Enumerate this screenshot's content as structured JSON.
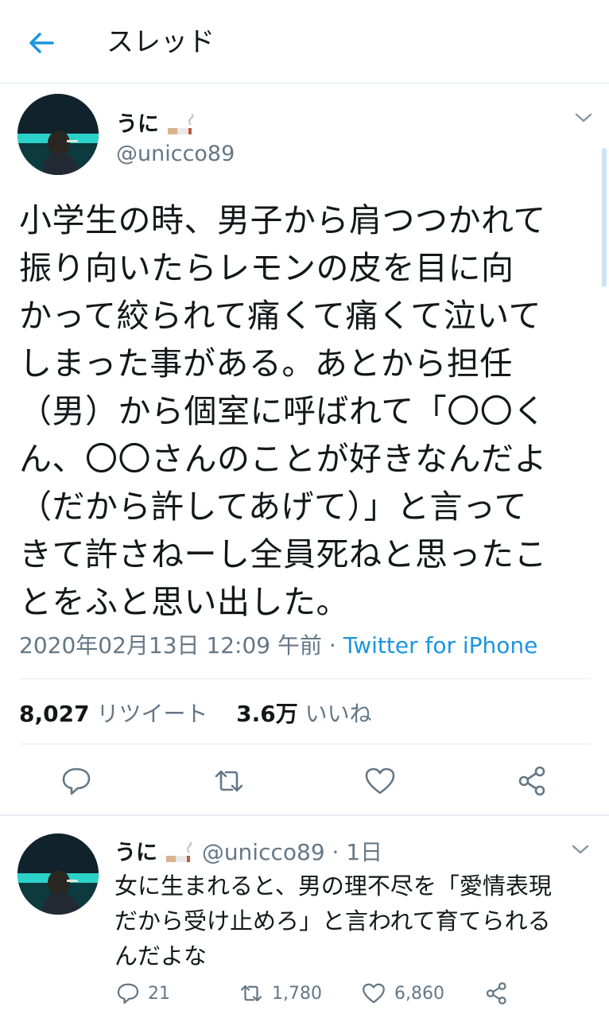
{
  "header": {
    "title": "スレッド",
    "back_icon": "arrow-left-icon"
  },
  "tweet": {
    "display_name": "うに",
    "handle": "@unicco89",
    "text_lines": [
      "小学生の時、男子から肩つつかれて",
      "振り向いたらレモンの皮を目に向",
      "かって絞られて痛くて痛くて泣いて",
      "しまった事がある。あとから担任",
      "（男）から個室に呼ばれて「〇〇く",
      "ん、〇〇さんのことが好きなんだよ",
      "（だから許してあげて）」と言って",
      "きて許さねーし全員死ねと思ったこ",
      "とをふと思い出した。"
    ],
    "timestamp": "2020年02月13日 12:09 午前",
    "meta_separator": "·",
    "source": "Twitter for iPhone",
    "retweet_count": "8,027",
    "retweet_label": "リツイート",
    "like_count": "3.6万",
    "like_label": "いいね"
  },
  "reply": {
    "display_name": "うに",
    "handle": "@unicco89",
    "time": "· 1日",
    "text_lines": [
      "女に生まれると、男の理不尽を「愛情表現",
      "だから受け止めろ」と言われて育てられる",
      "んだよな"
    ],
    "reply_count": "21",
    "retweet_count": "1,780",
    "like_count": "6,860"
  },
  "colors": {
    "accent": "#1b95e0",
    "muted": "#657786",
    "text": "#14171a",
    "divider": "#e6ecf0"
  }
}
